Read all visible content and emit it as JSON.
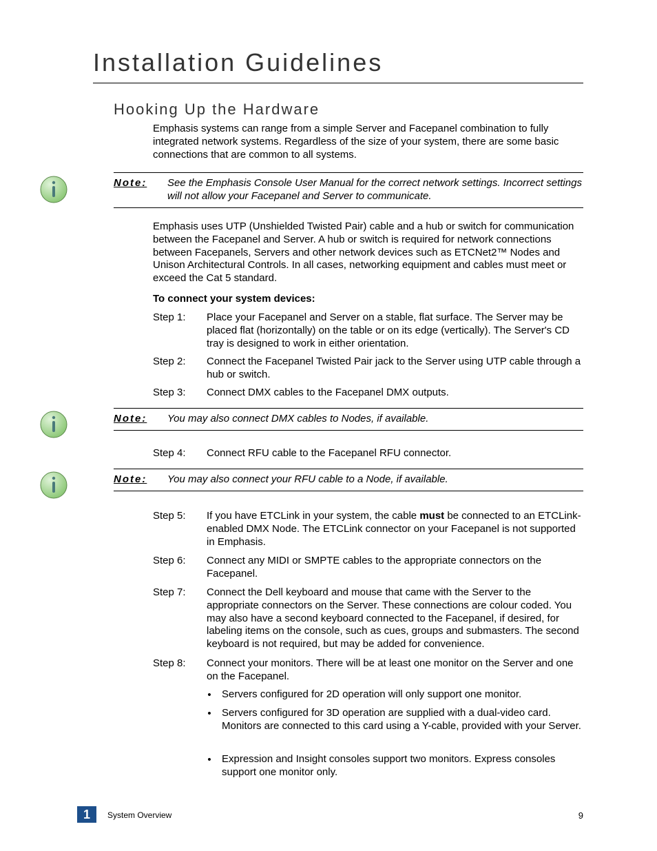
{
  "chapter_title": "Installation Guidelines",
  "section_title": "Hooking Up the Hardware",
  "intro_p1": "Emphasis systems can range from a simple Server and Facepanel combination to fully integrated network systems. Regardless of the size of your system, there are some basic connections that are common to all systems.",
  "note1": {
    "label": "Note:",
    "text": "See the Emphasis Console User Manual for the correct network settings. Incorrect settings will not allow your Facepanel and Server to communicate."
  },
  "intro_p2": "Emphasis uses UTP (Unshielded Twisted Pair) cable and a hub or switch for communication between the Facepanel and Server. A hub or switch is required for network connections between Facepanels, Servers and other network devices such as ETCNet2™ Nodes and Unison Architectural Controls. In all cases, networking equipment and cables must meet or exceed the Cat 5 standard.",
  "connect_heading": "To connect your system devices:",
  "steps": {
    "s1_label": "Step 1:",
    "s1_text": "Place your Facepanel and Server on a stable, flat surface. The Server may be placed flat (horizontally) on the table or on its edge (vertically). The Server's CD tray is designed to work in either orientation.",
    "s2_label": "Step 2:",
    "s2_text": "Connect the Facepanel Twisted Pair jack to the Server using UTP cable through a hub or switch.",
    "s3_label": "Step 3:",
    "s3_text": "Connect DMX cables to the Facepanel DMX outputs.",
    "s4_label": "Step 4:",
    "s4_text": "Connect RFU cable to the Facepanel RFU connector.",
    "s5_label": "Step 5:",
    "s5_pre": "If you have ETCLink in your system, the cable ",
    "s5_bold": "must",
    "s5_post": " be connected to an ETCLink-enabled DMX Node. The ETCLink connector on your Facepanel is not supported in Emphasis.",
    "s6_label": "Step 6:",
    "s6_text": "Connect any MIDI or SMPTE cables to the appropriate connectors on the Facepanel.",
    "s7_label": "Step 7:",
    "s7_text": "Connect the Dell keyboard and mouse that came with the Server to the appropriate connectors on the Server. These connections are colour coded. You may also have a second keyboard connected to the Facepanel, if desired, for labeling items on the console, such as cues, groups and submasters. The second keyboard is not required, but may be added for convenience.",
    "s8_label": "Step 8:",
    "s8_text": "Connect your monitors. There will be at least one monitor on the Server and one on the Facepanel."
  },
  "note2": {
    "label": "Note:",
    "text": "You may also connect DMX cables to Nodes, if available."
  },
  "note3": {
    "label": "Note:",
    "text": "You may also connect your RFU cable to a Node, if available."
  },
  "bullets": {
    "b1": "Servers configured for 2D operation will only support one monitor.",
    "b2": "Servers configured for 3D operation are supplied with a dual-video card. Monitors are connected to this card using a Y-cable, provided with your Server.",
    "b3": "Expression and Insight consoles support two monitors. Express consoles support one monitor only."
  },
  "footer": {
    "chapter_num": "1",
    "chapter_name": "System Overview",
    "page_num": "9"
  }
}
